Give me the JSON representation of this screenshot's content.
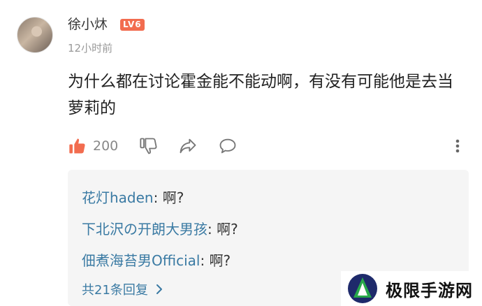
{
  "comment": {
    "username": "徐小炑",
    "level_badge": "LV6",
    "timestamp": "12小时前",
    "text": "为什么都在讨论霍金能不能动啊，有没有可能他是去当萝莉的",
    "like_count": "200"
  },
  "replies": [
    {
      "author": "花灯haden",
      "separator": ": ",
      "text": "啊?"
    },
    {
      "author": "下北沢の开朗大男孩",
      "separator": ": ",
      "text": "啊?"
    },
    {
      "author": "佃煮海苔男Official",
      "separator": ": ",
      "text": "啊?"
    }
  ],
  "more_replies_label": "共21条回复",
  "watermark": {
    "text": "极限手游网"
  },
  "icons": {
    "like": "thumbs-up-icon",
    "dislike": "thumbs-down-icon",
    "share": "share-icon",
    "reply": "comment-icon",
    "more": "more-vertical-icon",
    "expand": "chevron-right-icon"
  },
  "colors": {
    "accent": "#f26c4f",
    "link": "#3a7aa3",
    "muted": "#999999"
  }
}
